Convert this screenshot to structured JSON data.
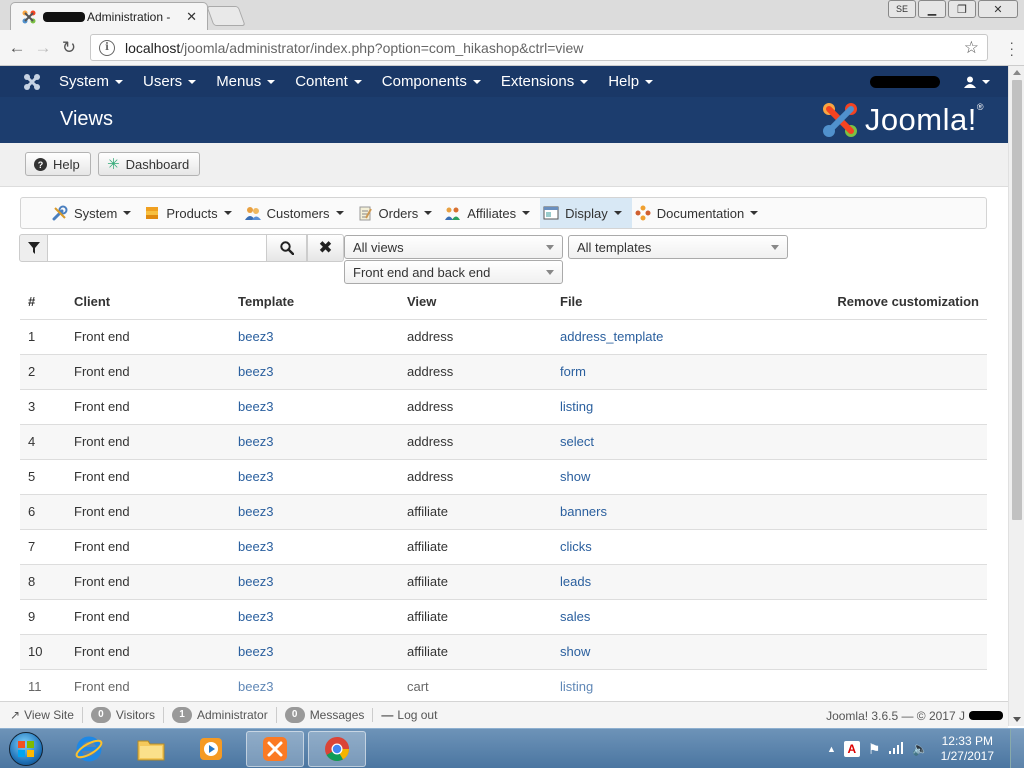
{
  "browser": {
    "tab_title": "Administration - ",
    "tab_close": "✕",
    "url_host": "localhost",
    "url_path": "/joomla/administrator/index.php?option=com_hikashop&ctrl=view",
    "info_glyph": "i"
  },
  "joomla_nav": {
    "items": [
      {
        "label": "System"
      },
      {
        "label": "Users"
      },
      {
        "label": "Menus"
      },
      {
        "label": "Content"
      },
      {
        "label": "Components"
      },
      {
        "label": "Extensions"
      },
      {
        "label": "Help"
      }
    ]
  },
  "header": {
    "page_title": "Views",
    "brand": "Joomla!",
    "brand_reg": "®"
  },
  "subtoolbar": {
    "help_label": "Help",
    "dashboard_label": "Dashboard"
  },
  "hikashop_menu": {
    "items": [
      {
        "label": "System",
        "icon": "wrench-icon"
      },
      {
        "label": "Products",
        "icon": "box-icon"
      },
      {
        "label": "Customers",
        "icon": "users-icon"
      },
      {
        "label": "Orders",
        "icon": "clipboard-icon"
      },
      {
        "label": "Affiliates",
        "icon": "people-icon"
      },
      {
        "label": "Display",
        "icon": "window-icon",
        "active": true
      },
      {
        "label": "Documentation",
        "icon": "help-flower-icon"
      }
    ]
  },
  "filters": {
    "search_value": "",
    "views_select": "All views",
    "templates_select": "All templates",
    "client_select": "Front end and back end"
  },
  "table": {
    "headers": {
      "num": "#",
      "client": "Client",
      "template": "Template",
      "view": "View",
      "file": "File",
      "remove": "Remove customization"
    },
    "rows": [
      {
        "num": "1",
        "client": "Front end",
        "template": "beez3",
        "view": "address",
        "file": "address_template"
      },
      {
        "num": "2",
        "client": "Front end",
        "template": "beez3",
        "view": "address",
        "file": "form"
      },
      {
        "num": "3",
        "client": "Front end",
        "template": "beez3",
        "view": "address",
        "file": "listing"
      },
      {
        "num": "4",
        "client": "Front end",
        "template": "beez3",
        "view": "address",
        "file": "select"
      },
      {
        "num": "5",
        "client": "Front end",
        "template": "beez3",
        "view": "address",
        "file": "show"
      },
      {
        "num": "6",
        "client": "Front end",
        "template": "beez3",
        "view": "affiliate",
        "file": "banners"
      },
      {
        "num": "7",
        "client": "Front end",
        "template": "beez3",
        "view": "affiliate",
        "file": "clicks"
      },
      {
        "num": "8",
        "client": "Front end",
        "template": "beez3",
        "view": "affiliate",
        "file": "leads"
      },
      {
        "num": "9",
        "client": "Front end",
        "template": "beez3",
        "view": "affiliate",
        "file": "sales"
      },
      {
        "num": "10",
        "client": "Front end",
        "template": "beez3",
        "view": "affiliate",
        "file": "show"
      },
      {
        "num": "11",
        "client": "Front end",
        "template": "beez3",
        "view": "cart",
        "file": "listing"
      }
    ]
  },
  "statusbar": {
    "view_site": "View Site",
    "visitors_count": "0",
    "visitors_label": "Visitors",
    "admin_count": "1",
    "admin_label": "Administrator",
    "messages_count": "0",
    "messages_label": "Messages",
    "logout": "Log out",
    "version": "Joomla! 3.6.5 — © 2017 J"
  },
  "taskbar": {
    "time": "12:33 PM",
    "date": "1/27/2017"
  },
  "colors": {
    "nav_bg": "#1a3867",
    "header_bg": "#1c3d6e",
    "link": "#2a5f9e"
  }
}
